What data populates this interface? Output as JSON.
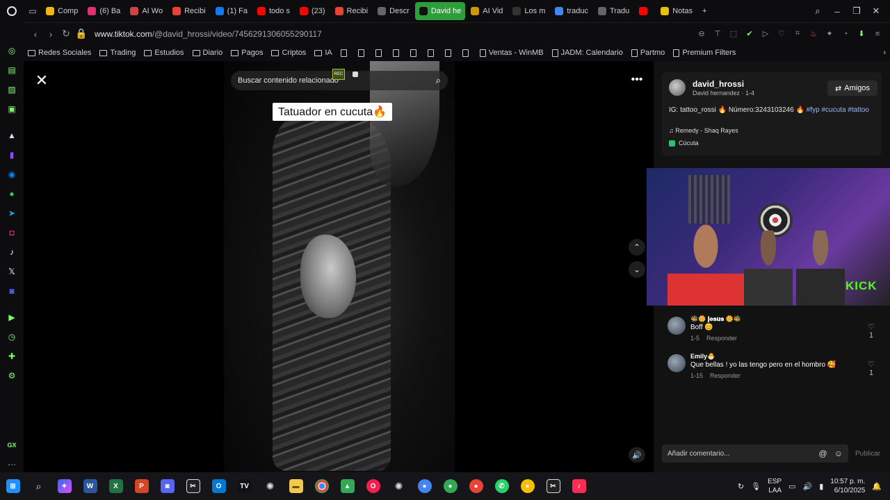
{
  "browser": {
    "tabs": [
      {
        "label": "Comp",
        "icon": "binance-icon",
        "color": "#f0b90b"
      },
      {
        "label": "(6) Ba",
        "icon": "instagram-icon",
        "color": "#e1306c"
      },
      {
        "label": "AI Wo",
        "icon": "ai-icon",
        "color": "#c44"
      },
      {
        "label": "Recibi",
        "icon": "gmail-icon",
        "color": "#ea4335"
      },
      {
        "label": "(1) Fa",
        "icon": "facebook-icon",
        "color": "#1877f2"
      },
      {
        "label": "todo s",
        "icon": "youtube-icon",
        "color": "#ff0000"
      },
      {
        "label": "(23)",
        "icon": "youtube-icon",
        "color": "#ff0000"
      },
      {
        "label": "Recibi",
        "icon": "gmail-icon",
        "color": "#ea4335"
      },
      {
        "label": "Descr",
        "icon": "chatgpt-icon",
        "color": "#666"
      },
      {
        "label": "David he",
        "icon": "tiktok-icon",
        "color": "#111",
        "active": true
      },
      {
        "label": "AI Vid",
        "icon": "ai-icon",
        "color": "#c90"
      },
      {
        "label": "Los m",
        "icon": "perplexity-icon",
        "color": "#333"
      },
      {
        "label": "traduc",
        "icon": "google-icon",
        "color": "#4285f4"
      },
      {
        "label": "Tradu",
        "icon": "chatgpt-icon",
        "color": "#666"
      },
      {
        "label": "",
        "icon": "youtube-icon",
        "color": "#ff0000"
      },
      {
        "label": "Notas",
        "icon": "notes-icon",
        "color": "#e6c200"
      }
    ],
    "url_host": "www.tiktok.com",
    "url_path": "/@david_hrossi/video/7456291306055290117",
    "bookmarks": [
      {
        "label": "Redes Sociales",
        "type": "folder"
      },
      {
        "label": "Trading",
        "type": "folder"
      },
      {
        "label": "Estudios",
        "type": "folder"
      },
      {
        "label": "Diario",
        "type": "folder"
      },
      {
        "label": "Pagos",
        "type": "folder"
      },
      {
        "label": "Criptos",
        "type": "folder"
      },
      {
        "label": "IA",
        "type": "folder"
      },
      {
        "label": "",
        "type": "page"
      },
      {
        "label": "",
        "type": "page"
      },
      {
        "label": "",
        "type": "page"
      },
      {
        "label": "",
        "type": "page"
      },
      {
        "label": "",
        "type": "page"
      },
      {
        "label": "",
        "type": "page"
      },
      {
        "label": "",
        "type": "page"
      },
      {
        "label": "",
        "type": "page"
      },
      {
        "label": "Ventas - WinMB",
        "type": "page"
      },
      {
        "label": "JADM: Calendario",
        "type": "page"
      },
      {
        "label": "Partmo",
        "type": "page"
      },
      {
        "label": "Premium Filters",
        "type": "page"
      }
    ]
  },
  "video": {
    "search_placeholder": "Buscar contenido relacionado",
    "rec_badge": "REC",
    "caption": "Tatuador en cucuta🔥"
  },
  "post": {
    "username": "david_hrossi",
    "subtitle": "David hernandez · 1-4",
    "follow_label": "Amigos",
    "description": "IG: tattoo_rossi 🔥 Número:3243103246 🔥",
    "hashtags": "#fyp #cucuta #tattoo",
    "music": "Remedy - Shaq Rayes",
    "location": "Cúcuta"
  },
  "stream": {
    "brand": "KICK"
  },
  "comments": [
    {
      "name": "🐝🌼 𝐣𝐞𝐬𝐮𝐬 🌼🐝",
      "text": "Boff 😊",
      "date": "1-5",
      "reply": "Responder",
      "likes": "1"
    },
    {
      "name": "Emily🐣",
      "text": "Que bellas ! yo las tengo pero en el hombro 🥰",
      "date": "1-15",
      "reply": "Responder",
      "likes": "1"
    }
  ],
  "comment_box": {
    "placeholder": "Añadir comentario...",
    "publish": "Publicar"
  },
  "taskbar": {
    "language": "ESP",
    "layout": "LAA",
    "time": "10:57 p. m.",
    "date": "6/10/2025"
  },
  "sidebar_label": "GX"
}
